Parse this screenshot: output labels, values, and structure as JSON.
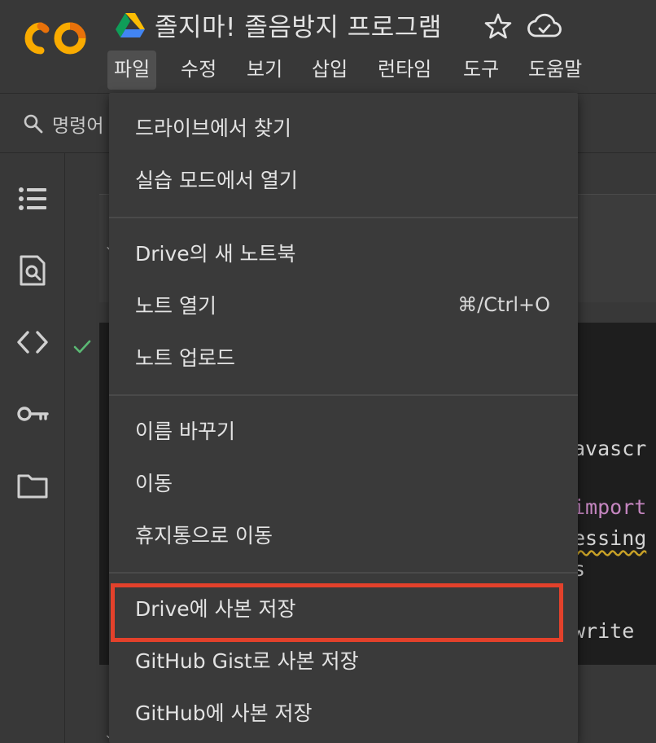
{
  "header": {
    "title": "졸지마! 졸음방지 프로그램",
    "logo_text": "CO"
  },
  "menubar": {
    "items": [
      "파일",
      "수정",
      "보기",
      "삽입",
      "런타임",
      "도구",
      "도움말"
    ],
    "active": "파일"
  },
  "toolbar": {
    "search_label": "명령어"
  },
  "left_rail": {
    "icons": [
      "table-of-contents-icon",
      "find-icon",
      "code-snippets-icon",
      "secrets-key-icon",
      "files-folder-icon"
    ]
  },
  "code_cell": {
    "lines": [
      {
        "text": "avascr",
        "kind": "plain"
      },
      {
        "text": "import",
        "kind": "keyword"
      },
      {
        "text": "essing",
        "kind": "squiggle"
      },
      {
        "text": "s",
        "kind": "plain"
      },
      {
        "text": "write",
        "kind": "plain"
      }
    ]
  },
  "file_menu": {
    "groups": [
      [
        {
          "label": "드라이브에서 찾기"
        },
        {
          "label": "실습 모드에서 열기"
        }
      ],
      [
        {
          "label": "Drive의 새 노트북"
        },
        {
          "label": "노트 열기",
          "shortcut": "⌘/Ctrl+O"
        },
        {
          "label": "노트 업로드"
        }
      ],
      [
        {
          "label": "이름 바꾸기"
        },
        {
          "label": "이동"
        },
        {
          "label": "휴지통으로 이동"
        }
      ],
      [
        {
          "label": "Drive에 사본 저장"
        },
        {
          "label": "GitHub Gist로 사본 저장"
        },
        {
          "label": "GitHub에 사본 저장"
        }
      ]
    ],
    "highlighted": "Drive에 사본 저장"
  },
  "colors": {
    "background": "#383838",
    "menu_background": "#3a3a3a",
    "highlight_border": "#e3412b",
    "logo_orange": "#f9ab00",
    "logo_dark_orange": "#e8710a",
    "check_green": "#5bb974",
    "keyword_purple": "#c586c0"
  }
}
